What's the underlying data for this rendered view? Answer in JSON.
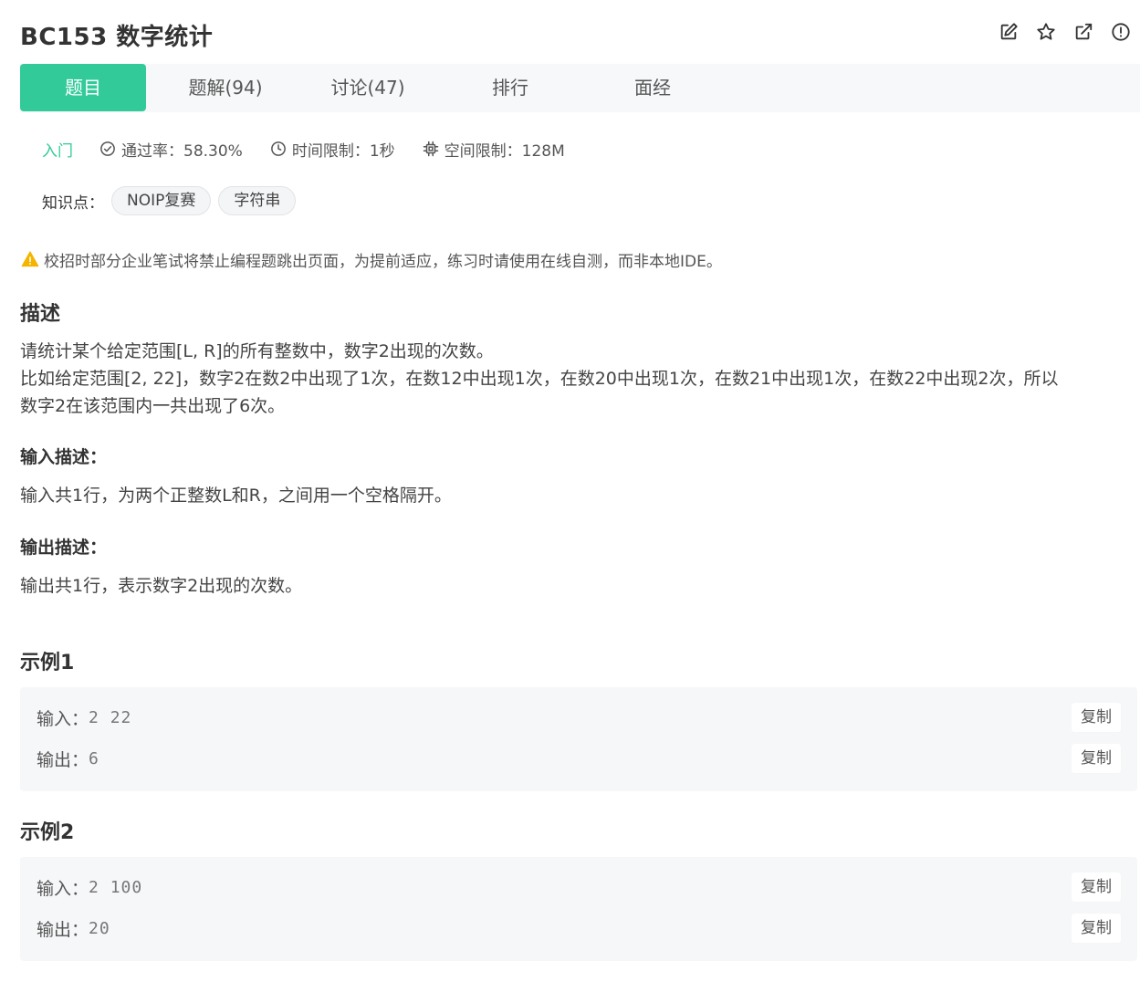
{
  "header": {
    "title": "BC153  数字统计",
    "icons": [
      "edit-icon",
      "star-icon",
      "external-link-icon",
      "info-icon"
    ]
  },
  "tabs": [
    {
      "label": "题目",
      "active": true
    },
    {
      "label": "题解(94)",
      "active": false
    },
    {
      "label": "讨论(47)",
      "active": false
    },
    {
      "label": "排行",
      "active": false
    },
    {
      "label": "面经",
      "active": false
    }
  ],
  "meta": {
    "level": "入门",
    "pass_rate": "通过率：58.30%",
    "time_limit": "时间限制：1秒",
    "memory_limit": "空间限制：128M"
  },
  "knowledge": {
    "label": "知识点：",
    "tags": [
      "NOIP复赛",
      "字符串"
    ]
  },
  "warning": "校招时部分企业笔试将禁止编程题跳出页面，为提前适应，练习时请使用在线自测，而非本地IDE。",
  "description": {
    "heading": "描述",
    "lines": [
      "请统计某个给定范围[L, R]的所有整数中，数字2出现的次数。",
      "比如给定范围[2, 22]，数字2在数2中出现了1次，在数12中出现1次，在数20中出现1次，在数21中出现1次，在数22中出现2次，所以",
      "数字2在该范围内一共出现了6次。"
    ]
  },
  "input_desc": {
    "heading": "输入描述：",
    "text": "输入共1行，为两个正整数L和R，之间用一个空格隔开。"
  },
  "output_desc": {
    "heading": "输出描述：",
    "text": "输出共1行，表示数字2出现的次数。"
  },
  "examples": [
    {
      "heading": "示例1",
      "input_label": "输入：",
      "input": "2 22",
      "output_label": "输出：",
      "output": "6",
      "copy_label": "复制"
    },
    {
      "heading": "示例2",
      "input_label": "输入：",
      "input": "2 100",
      "output_label": "输出：",
      "output": "20",
      "copy_label": "复制"
    }
  ],
  "colors": {
    "accent": "#32ca99",
    "warning": "#f5b400"
  }
}
